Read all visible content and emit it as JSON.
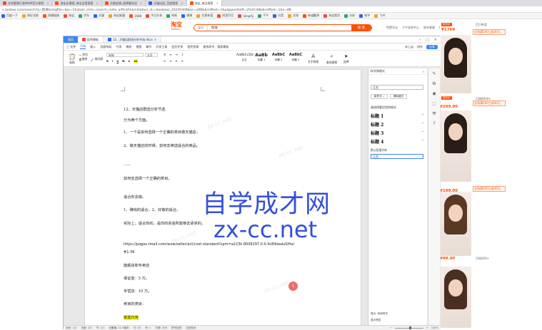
{
  "browser": {
    "tabs": [
      {
        "label": "在线看爬行类WoW官方视频",
        "color": "#e74c3c"
      },
      {
        "label": "淘宝全景图_淘宝全套搜索",
        "color": "#ff5000"
      },
      {
        "label": "天猫店铺_选择最合适",
        "color": "#ff5000"
      },
      {
        "label": "天猫店面_百度搜索",
        "color": "#2d64e6"
      },
      {
        "label": "淘宝_商品搜索",
        "color": "#ff5000"
      }
    ],
    "address": "s.taobao.com/search?q=假发&imgfile=&js=1&stats_click=search_radio_all%3A1&initiative_id=staobaoz_20230308&ie=utf8&bcoffset=1&p4ppushleft=2%2C48&bcoffset=1&s=88",
    "bookmarks": [
      "百度一下",
      "网址导航",
      "快捷链接",
      "淘宝",
      "京东",
      "天猫",
      "淘宝联盟",
      "1688",
      "今日头条",
      "网易",
      "微博",
      "生意参谋",
      "阿里巴巴",
      "Shopify",
      "千牛",
      "抖音",
      "文档",
      "有道翻译",
      "淘宝首页",
      "分析",
      "知乎",
      "飞书"
    ]
  },
  "taobao": {
    "logo": "淘宝",
    "logo_sub": "Taobao",
    "search_category": "宝贝",
    "search_query": "假发",
    "search_button": "搜 索",
    "right_links": [
      "免费开店",
      "千牛卖家中心",
      "联系客服",
      "网站导航"
    ]
  },
  "ads": [
    {
      "price": "¥1769",
      "promo": "全场满500立减30元",
      "right": "百万种类",
      "badge": "到手价"
    },
    {
      "price": "¥299.00",
      "promo": "全场满500立减30元",
      "right": "月销8000+",
      "badge": "到手价"
    },
    {
      "price": "¥199.00",
      "promo": "全场满500立减30元",
      "right": "",
      "badge": ""
    },
    {
      "price": "¥99.00",
      "promo": "",
      "right": "月销400+",
      "badge": ""
    },
    {
      "price": "",
      "promo": "",
      "right": "",
      "badge": ""
    }
  ],
  "wps": {
    "home": "首页",
    "tabs": [
      "稻壳模板",
      "12、天猫店群选分析节选.docx"
    ],
    "menu": [
      "三 文件",
      "开始",
      "插入",
      "页面布局",
      "引用",
      "审阅",
      "视图",
      "章节",
      "开发工具",
      "会员专享",
      "稻壳资源",
      "查找命令、搜索模板"
    ],
    "menu_right": [
      "未上云",
      "协作",
      "分享"
    ],
    "ribbon": {
      "paste": "粘贴",
      "cut": "剪切",
      "copy": "复制",
      "format_painter": "格式刷",
      "font": "宋体",
      "size": "五号",
      "styles": [
        {
          "sample": "AaBbCcDd",
          "label": "正文"
        },
        {
          "sample": "AaBb",
          "label": "标题 1"
        },
        {
          "sample": "AaBbC",
          "label": "标题 2"
        },
        {
          "sample": "AaBbC",
          "label": "标题 3"
        }
      ],
      "text_tools": "文字排版",
      "find_replace": "查找替换",
      "select": "选择"
    },
    "document": {
      "paragraphs": [
        {
          "text": "12、天猫店群选分析节选",
          "type": "normal"
        },
        {
          "text": "分为两个方面。",
          "type": "normal"
        },
        {
          "text": "1、一个是如何选择一个正确的类目做天猫店，",
          "type": "normal"
        },
        {
          "text": "2、做天猫店的时候，如何去筛选适合的商品。",
          "type": "normal"
        },
        {
          "text": "……",
          "type": "normal"
        },
        {
          "text": "如何去选择一个正确的类目。",
          "type": "normal"
        },
        {
          "text": "适合你去做。",
          "type": "normal"
        },
        {
          "text": "1、赚钱的适合，2、好做的适合。",
          "type": "normal"
        },
        {
          "text": "实际上，适合你的，是你的资金所能够去承受的。",
          "type": "normal"
        },
        {
          "text": "https://pages.tmall.com/wow/seller/act/cost-standard?spm=a223k.8006297.0.0.4c84daduSIHai",
          "type": "link"
        },
        {
          "text": "#1:36",
          "type": "link"
        },
        {
          "text": "旗舰店和专卖店",
          "type": "normal"
        },
        {
          "text": "保证金：5 万。",
          "type": "normal"
        },
        {
          "text": "专营店：10 万。",
          "type": "normal"
        },
        {
          "text": "卖家的类目：",
          "type": "normal"
        },
        {
          "text": "家庭日用",
          "type": "highlight"
        }
      ],
      "watermark_cn": "自学成才网",
      "watermark_url": "zx-cc.net",
      "ghost_text": "zx-cc.net",
      "cursor_badge": "1"
    },
    "pane": {
      "title": "样式和格式",
      "current_style": "正文",
      "new_style": "新样式...",
      "clear_format": "清除格式",
      "apply_label": "请选择要应用的格式",
      "headings": [
        "标题 1",
        "标题 2",
        "标题 3",
        "标题 4"
      ],
      "show_section": "默认段落字体",
      "style_select": "正文",
      "show_label": "显示: 有效样式",
      "preview_label": "显示预览"
    },
    "status": {
      "page": "页码: 1/2",
      "pages": "页面: 1/2",
      "section": "节: 1/1",
      "row": "设置值: 11.9厘米",
      "line": "行: 20",
      "col": "列: 1",
      "words": "字数: 338",
      "spell": "拼写检查",
      "doc_check": "文档校对",
      "zoom": "100%"
    }
  }
}
